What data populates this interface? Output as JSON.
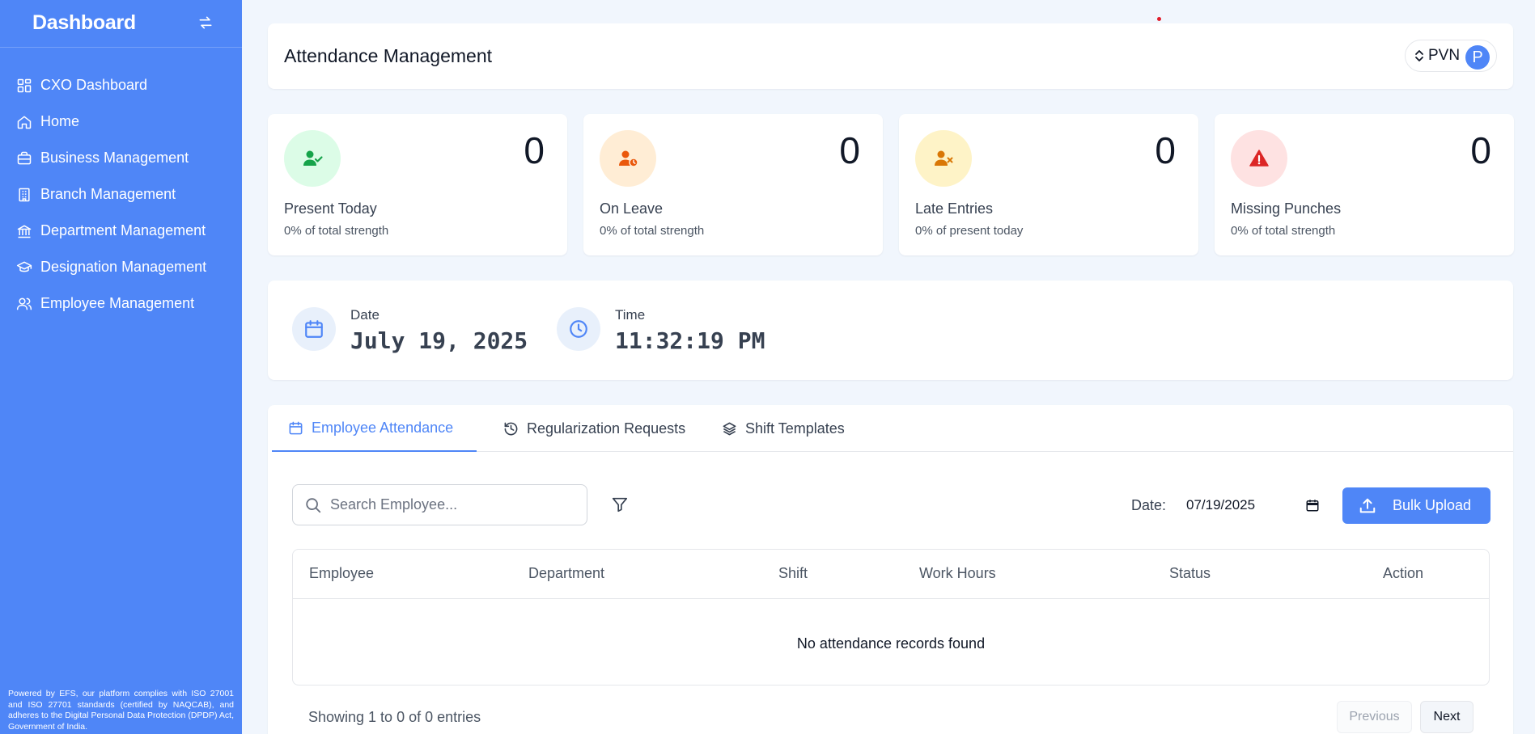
{
  "sidebar": {
    "title": "Dashboard",
    "items": [
      {
        "label": "CXO Dashboard",
        "icon": "grid-icon"
      },
      {
        "label": "Home",
        "icon": "home-icon"
      },
      {
        "label": "Business Management",
        "icon": "briefcase-icon"
      },
      {
        "label": "Branch Management",
        "icon": "building-icon"
      },
      {
        "label": "Department Management",
        "icon": "landmark-icon"
      },
      {
        "label": "Designation Management",
        "icon": "graduation-cap-icon"
      },
      {
        "label": "Employee Management",
        "icon": "users-icon"
      }
    ],
    "footer": "Powered by EFS, our platform complies with ISO 27001 and ISO 27701 standards (certified by NAQCAB), and adheres to the Digital Personal Data Protection (DPDP) Act, Government of India."
  },
  "header": {
    "title": "Attendance Management",
    "user": {
      "name": "PVN",
      "avatar_letter": "P"
    }
  },
  "stats": [
    {
      "value": "0",
      "label": "Present Today",
      "sub": "0% of total strength",
      "icon": "user-check-icon",
      "color": "#16a34a",
      "bg": "#dcfce7"
    },
    {
      "value": "0",
      "label": "On Leave",
      "sub": "0% of total strength",
      "icon": "user-clock-icon",
      "color": "#ea580c",
      "bg": "#ffedd5"
    },
    {
      "value": "0",
      "label": "Late Entries",
      "sub": "0% of present today",
      "icon": "user-x-icon",
      "color": "#d97706",
      "bg": "#fef3c7"
    },
    {
      "value": "0",
      "label": "Missing Punches",
      "sub": "0% of total strength",
      "icon": "alert-triangle-icon",
      "color": "#dc2626",
      "bg": "#fee2e2"
    }
  ],
  "datetime": {
    "date_label": "Date",
    "date_value": "July 19, 2025",
    "time_label": "Time",
    "time_value": "11:32:19 PM"
  },
  "tabs": [
    {
      "label": "Employee Attendance",
      "icon": "calendar-icon",
      "active": true
    },
    {
      "label": "Regularization Requests",
      "icon": "history-icon",
      "active": false
    },
    {
      "label": "Shift Templates",
      "icon": "layers-icon",
      "active": false
    }
  ],
  "toolbar": {
    "search_placeholder": "Search Employee...",
    "date_label": "Date:",
    "date_value": "07/19/2025",
    "bulk_upload_label": "Bulk Upload"
  },
  "table": {
    "columns": [
      "Employee",
      "Department",
      "Shift",
      "Work Hours",
      "Status",
      "Action"
    ],
    "empty_message": "No attendance records found"
  },
  "pagination": {
    "summary": "Showing 1 to 0 of 0 entries",
    "previous_label": "Previous",
    "next_label": "Next"
  },
  "colors": {
    "primary": "#4f86f7",
    "background": "#f1f6fd"
  }
}
